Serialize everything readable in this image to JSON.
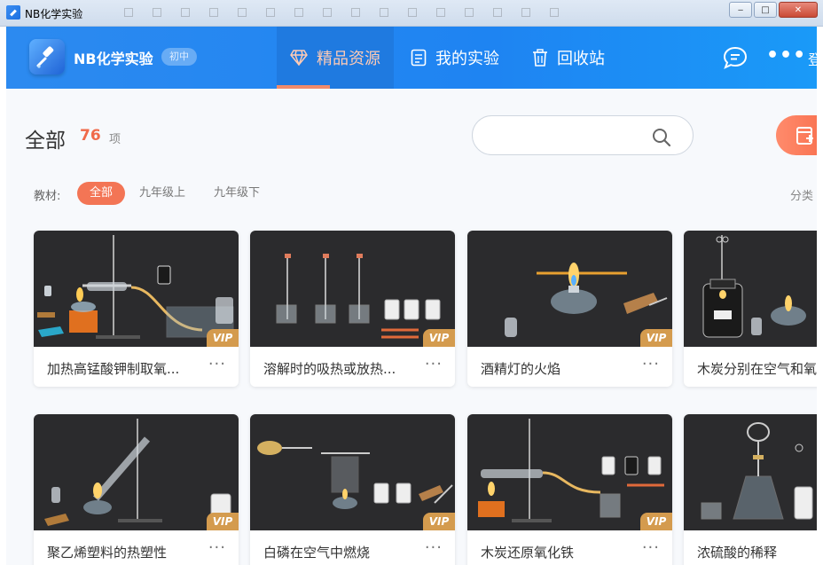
{
  "window": {
    "title": "NB化学实验"
  },
  "header": {
    "brand": "NB化学实验",
    "level": "初中",
    "tabs": [
      {
        "label": "精品资源",
        "icon": "diamond-icon",
        "active": true
      },
      {
        "label": "我的实验",
        "icon": "document-icon",
        "active": false
      },
      {
        "label": "回收站",
        "icon": "trash-icon",
        "active": false
      }
    ],
    "login": "登"
  },
  "summary": {
    "title": "全部",
    "count": "76",
    "unit": "项"
  },
  "search": {
    "placeholder": ""
  },
  "filters": {
    "label": "教材:",
    "options": [
      "全部",
      "九年级上",
      "九年级下"
    ],
    "active": "全部",
    "sort_label": "分类"
  },
  "cards": [
    {
      "title": "加热高锰酸钾制取氧...",
      "badge": "VIP",
      "more": "···"
    },
    {
      "title": "溶解时的吸热或放热...",
      "badge": "VIP",
      "more": "···"
    },
    {
      "title": "酒精灯的火焰",
      "badge": "VIP",
      "more": "···"
    },
    {
      "title": "木炭分别在空气和氧",
      "badge": "",
      "more": "···"
    },
    {
      "title": "聚乙烯塑料的热塑性",
      "badge": "VIP",
      "more": "···"
    },
    {
      "title": "白磷在空气中燃烧",
      "badge": "VIP",
      "more": "···"
    },
    {
      "title": "木炭还原氧化铁",
      "badge": "VIP",
      "more": "···"
    },
    {
      "title": "浓硫酸的稀释",
      "badge": "",
      "more": "···"
    }
  ],
  "colors": {
    "header": "#1e84f2",
    "accent": "#f37555",
    "vip": "#d49b4e",
    "thumb_bg": "#2b2b2d"
  }
}
